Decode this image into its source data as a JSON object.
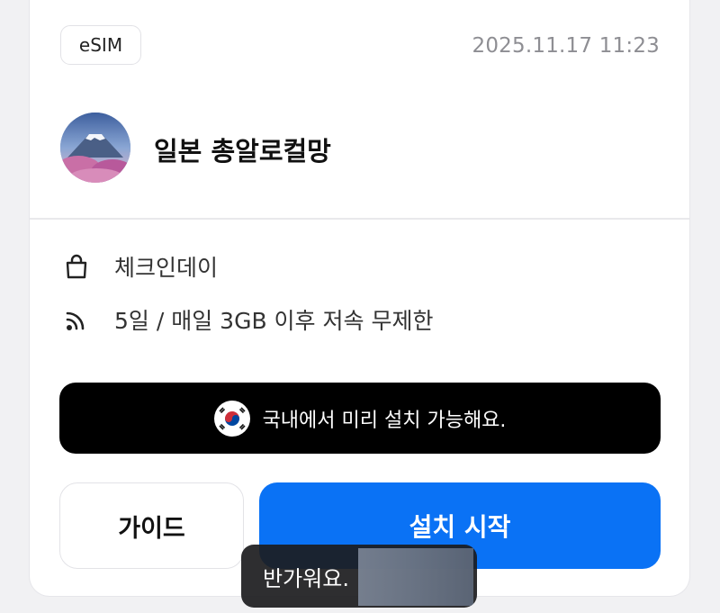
{
  "card": {
    "badge": "eSIM",
    "timestamp": "2025.11.17 11:23",
    "product_name": "일본 총알로컬망",
    "details": [
      {
        "icon": "shopping-bag-icon",
        "text": "체크인데이"
      },
      {
        "icon": "signal-icon",
        "text": "5일 / 매일 3GB 이후 저속 무제한"
      }
    ],
    "banner": {
      "icon": "korea-flag-icon",
      "text": "국내에서 미리 설치 가능해요."
    },
    "buttons": {
      "guide": "가이드",
      "install": "설치 시작"
    }
  },
  "toast": {
    "text": "반가워요."
  },
  "colors": {
    "accent": "#0a72f5",
    "banner_bg": "#000000",
    "muted_text": "#8e8e93"
  }
}
